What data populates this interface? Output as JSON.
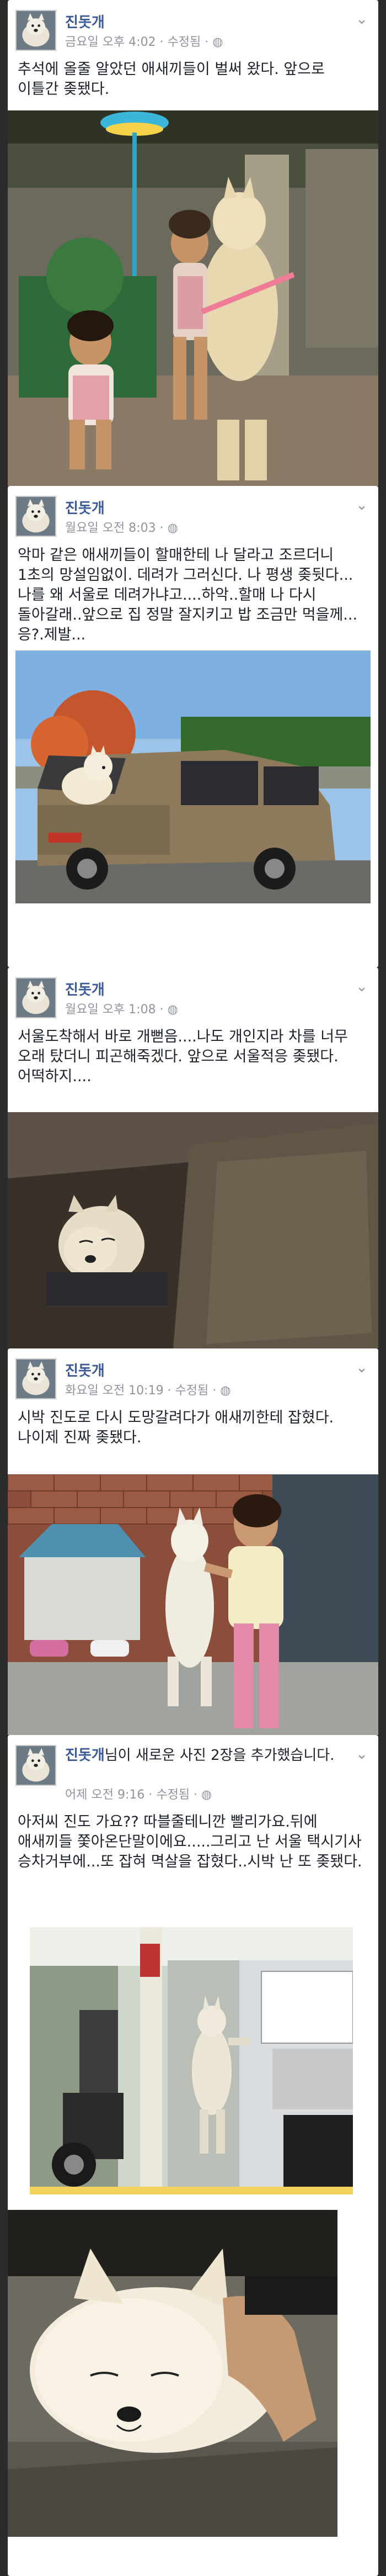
{
  "posts": [
    {
      "author": "진돗개",
      "time": "금요일 오후 4:02 · 수정됨 · ",
      "text": "추석에 올줄 알았던 애새끼들이 벌써 왔다. 앞으로 이틀간 좆됐다."
    },
    {
      "author": "진돗개",
      "time": "월요일 오전 8:03 · ",
      "text": "악마 같은 애새끼들이 할매한테 나 달라고 조르더니 1초의 망설임없이. 데려가 그러신다. 나 평생 좆뒷다... 나를 왜 서울로 데려가냐고....하악..할매 나 다시 돌아갈래..앞으로 집 정말 잘지키고 밥 조금만 먹을께...응?.제발..."
    },
    {
      "author": "진돗개",
      "time": "월요일 오후 1:08 · ",
      "text": "서울도착해서 바로 개뻗음....나도 개인지라 차를 너무 오래 탔더니 피곤해죽겠다. 앞으로 서울적응 좆됐다. 어떡하지...."
    },
    {
      "author": "진돗개",
      "time": "화요일 오전 10:19 · 수정됨 · ",
      "text": "시박 진도로 다시 도망갈려다가 애새끼한테 잡혔다. 나이제 진짜 좆됐다."
    },
    {
      "author": "진돗개",
      "author_suffix": "님이 새로운 사진 2장을 추가했습니다.",
      "time": "어제 오전 9:16 · 수정됨 · ",
      "text": "아저씨 진도 가요?? 따블줄테니깐 빨리가요.뒤에 애새끼들 쫓아온단말이에요.....그리고 난 서울 택시기사 승차거부에...또 잡혀 멱살을 잡혔다..시박 난 또 좆됐다."
    }
  ],
  "icons": {
    "globe": "globe-icon",
    "chevron": "chevron-down-icon"
  },
  "colors": {
    "author": "#3b5998",
    "meta": "#90949c",
    "text": "#1d2129",
    "background": "#2b2b2b"
  }
}
